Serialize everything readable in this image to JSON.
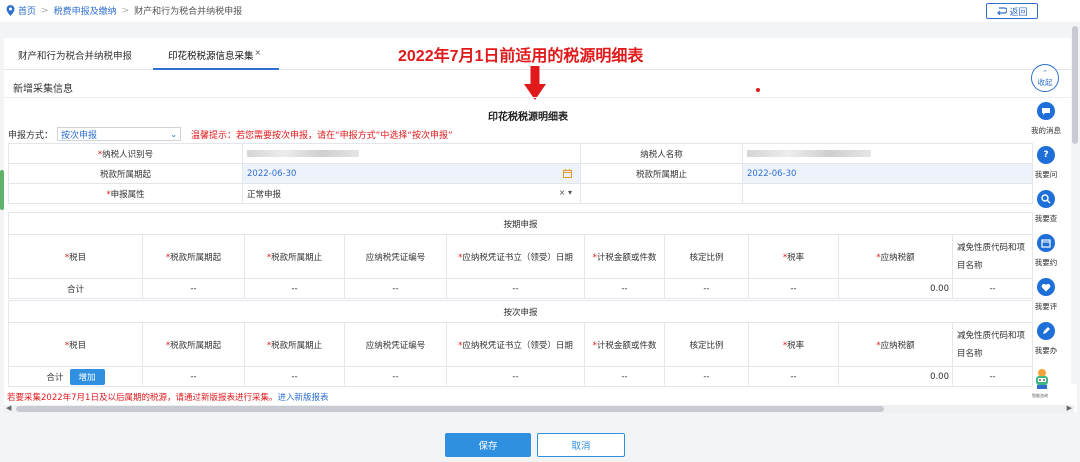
{
  "breadcrumb": {
    "home": "首页",
    "separator": ">",
    "level1": "税费申报及缴纳",
    "level2": "财产和行为税合并纳税申报"
  },
  "header": {
    "back_label": "返回"
  },
  "tabs": [
    {
      "label": "财产和行为税合并纳税申报",
      "active": false
    },
    {
      "label": "印花税税源信息采集",
      "active": true,
      "close": "×"
    }
  ],
  "annotation": {
    "title": "2022年7月1日前适用的税源明细表"
  },
  "section": {
    "title": "新增采集信息"
  },
  "form": {
    "title": "印花税税源明细表",
    "mode_label": "申报方式：",
    "mode_value": "按次申报",
    "mode_tip": "温馨提示：若您需要按次申报，请在“申报方式”中选择“按次申报”"
  },
  "info": {
    "taxpayer_id_label": "纳税人识别号",
    "taxpayer_name_label": "纳税人名称",
    "period_start_label": "税款所属期起",
    "period_start_value": "2022-06-30",
    "period_end_label": "税款所属期止",
    "period_end_value": "2022-06-30",
    "attr_label": "申报属性",
    "attr_value": "正常申报",
    "attr_clear": "×"
  },
  "periodic": {
    "band_title": "按期申报",
    "columns": [
      "税目",
      "税款所属期起",
      "税款所属期止",
      "应纳税凭证编号",
      "应纳税凭证书立（领受）日期",
      "计税金额或件数",
      "核定比例",
      "税率",
      "应纳税额",
      "减免性质代码和项目名称"
    ],
    "total_label": "合计",
    "cells": [
      "--",
      "--",
      "--",
      "--",
      "--",
      "--",
      "--",
      "0.00",
      "--"
    ]
  },
  "per_time": {
    "band_title": "按次申报",
    "columns": [
      "税目",
      "税款所属期起",
      "税款所属期止",
      "应纳税凭证编号",
      "应纳税凭证书立（领受）日期",
      "计税金额或件数",
      "核定比例",
      "税率",
      "应纳税额",
      "减免性质代码和项目名称"
    ],
    "total_label": "合计",
    "add_label": "增加",
    "cells": [
      "--",
      "--",
      "--",
      "--",
      "--",
      "--",
      "--",
      "0.00",
      "--"
    ]
  },
  "footer": {
    "note": "若要采集2022年7月1日及以后属期的税源，请通过新版报表进行采集。",
    "link": "进入新版报表",
    "save_label": "保存",
    "cancel_label": "取消"
  },
  "rail": {
    "collapse_label": "收起",
    "items": [
      {
        "label": "我的消息",
        "icon": "message-icon"
      },
      {
        "label": "我要问",
        "icon": "question-icon"
      },
      {
        "label": "我要查",
        "icon": "search-icon"
      },
      {
        "label": "我要约",
        "icon": "calendar-icon"
      },
      {
        "label": "我要评",
        "icon": "heart-icon"
      },
      {
        "label": "我要办",
        "icon": "pencil-icon"
      }
    ],
    "robot_label": "智能咨询"
  },
  "colors": {
    "primary": "#2f6fcf",
    "button": "#2f8fe0",
    "warning": "#e0191b",
    "highlight": "#eef3fb"
  }
}
